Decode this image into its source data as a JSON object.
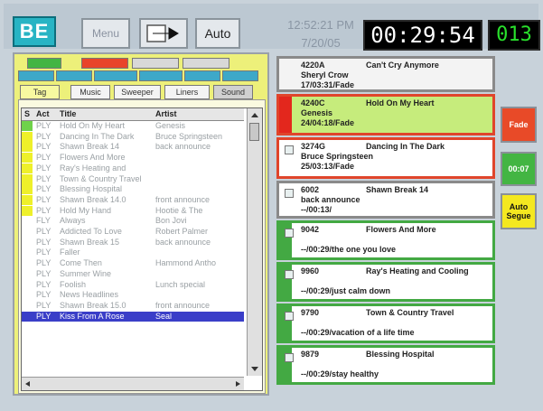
{
  "toolbar": {
    "logo": "BE",
    "menu_label": "Menu",
    "auto_label": "Auto",
    "clock_time": "12:52:21 PM",
    "clock_date": "7/20/05",
    "countdown": "00:29:54",
    "counter": "013"
  },
  "library": {
    "filter_tabs": [
      "Tag",
      "Music",
      "Sweeper",
      "Liners",
      "Sound"
    ],
    "columns": [
      "S",
      "Act",
      "Title",
      "Artist"
    ],
    "rows": [
      {
        "act": "PLY",
        "title": "Hold On My Heart",
        "artist": "Genesis",
        "mark": "#6fd24a"
      },
      {
        "act": "PLY",
        "title": "Dancing In The Dark",
        "artist": "Bruce Springsteen",
        "mark": "#eef02a"
      },
      {
        "act": "PLY",
        "title": "Shawn Break 14",
        "artist": "back announce",
        "mark": "#eef02a"
      },
      {
        "act": "PLY",
        "title": "Flowers And More",
        "artist": "",
        "mark": "#eef02a"
      },
      {
        "act": "PLY",
        "title": "Ray's Heating and",
        "artist": "",
        "mark": "#eef02a"
      },
      {
        "act": "PLY",
        "title": "Town & Country Travel",
        "artist": "",
        "mark": "#eef02a"
      },
      {
        "act": "PLY",
        "title": "Blessing Hospital",
        "artist": "",
        "mark": "#eef02a"
      },
      {
        "act": "PLY",
        "title": "Shawn Break 14.0",
        "artist": "front announce",
        "mark": "#eef02a"
      },
      {
        "act": "PLY",
        "title": "Hold My Hand",
        "artist": "Hootie & The",
        "mark": "#eef02a"
      },
      {
        "act": "FLY",
        "title": "Always",
        "artist": "Bon Jovi",
        "mark": ""
      },
      {
        "act": "PLY",
        "title": "Addicted To Love",
        "artist": "Robert Palmer",
        "mark": ""
      },
      {
        "act": "PLY",
        "title": "Shawn Break 15",
        "artist": "back announce",
        "mark": ""
      },
      {
        "act": "PLY",
        "title": "Faller",
        "artist": "",
        "mark": ""
      },
      {
        "act": "PLY",
        "title": "Come Then",
        "artist": "Hammond Antho",
        "mark": ""
      },
      {
        "act": "PLY",
        "title": "Summer Wine",
        "artist": "",
        "mark": ""
      },
      {
        "act": "PLY",
        "title": "Foolish",
        "artist": "Lunch special",
        "mark": ""
      },
      {
        "act": "PLY",
        "title": "News Headlines",
        "artist": "",
        "mark": ""
      },
      {
        "act": "PLY",
        "title": "Shawn Break 15.0",
        "artist": "front announce",
        "mark": ""
      },
      {
        "act": "PLY",
        "title": "Kiss From A Rose",
        "artist": "Seal",
        "mark": "",
        "selected": true
      }
    ]
  },
  "playlist": [
    {
      "cart": "4220A",
      "title": "Can't Cry Anymore",
      "line2": "Sheryl Crow",
      "line3": "17/03:31/Fade",
      "bg": "#f3f3f3",
      "border": "#8a8a8a",
      "stripe": "#f3f3f3",
      "icon": false
    },
    {
      "cart": "4240C",
      "title": "Hold On My Heart",
      "line2": "Genesis",
      "line3": "24/04:18/Fade",
      "bg": "#c6ec7c",
      "border": "#e0452b",
      "stripe": "#e3271d",
      "icon": false
    },
    {
      "cart": "3274G",
      "title": "Dancing In The Dark",
      "line2": "Bruce Springsteen",
      "line3": "25/03:13/Fade",
      "bg": "#ffffff",
      "border": "#e0452b",
      "stripe": "#ffffff",
      "icon": true
    },
    {
      "cart": "6002",
      "title": "Shawn Break 14",
      "line2": "back announce",
      "line3": "--/00:13/",
      "bg": "#ffffff",
      "border": "#8a8a8a",
      "stripe": "#ffffff",
      "icon": true
    },
    {
      "cart": "9042",
      "title": "Flowers And More",
      "line2": "",
      "line3": "--/00:29/the one you love",
      "bg": "#ffffff",
      "border": "#43a943",
      "stripe": "#43a943",
      "icon": true
    },
    {
      "cart": "9960",
      "title": "Ray's Heating and Cooling",
      "line2": "",
      "line3": "--/00:29/just calm down",
      "bg": "#ffffff",
      "border": "#43a943",
      "stripe": "#43a943",
      "icon": true
    },
    {
      "cart": "9790",
      "title": "Town & Country Travel",
      "line2": "",
      "line3": "--/00:29/vacation of a life time",
      "bg": "#ffffff",
      "border": "#43a943",
      "stripe": "#43a943",
      "icon": true
    },
    {
      "cart": "9879",
      "title": "Blessing Hospital",
      "line2": "",
      "line3": "--/00:29/stay healthy",
      "bg": "#ffffff",
      "border": "#43a943",
      "stripe": "#43a943",
      "icon": true
    }
  ],
  "side_buttons": [
    {
      "label": "Fade",
      "bg": "#e84a28",
      "color": "#ffffff"
    },
    {
      "label": "00:07",
      "bg": "#43b543",
      "color": "#ffffff"
    },
    {
      "label": "Auto Segue",
      "bg": "#f4e820",
      "color": "#111111"
    }
  ]
}
